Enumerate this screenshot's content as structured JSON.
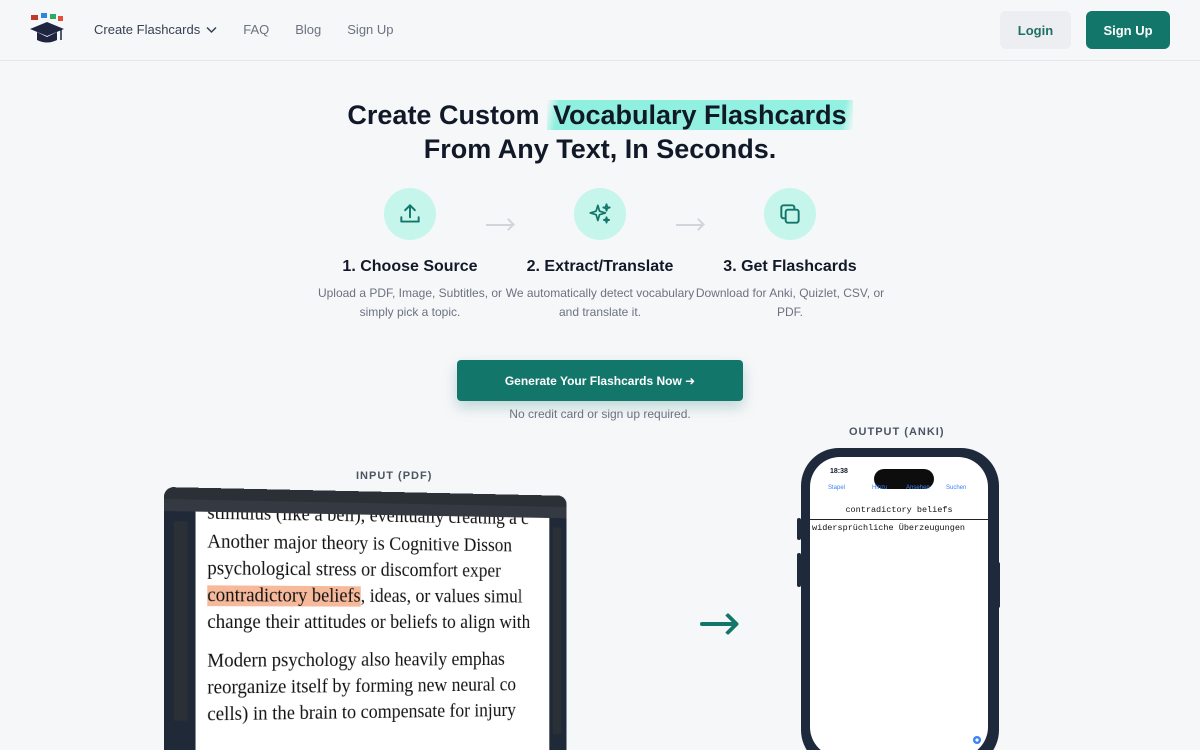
{
  "nav": {
    "menu_label": "Create Flashcards",
    "faq": "FAQ",
    "blog": "Blog",
    "signup_link": "Sign Up",
    "login_button": "Login",
    "signup_button": "Sign Up"
  },
  "hero": {
    "title_part1": "Create Custom",
    "title_highlight": "Vocabulary Flashcards",
    "title_line2": "From Any Text, In Seconds."
  },
  "steps": [
    {
      "icon": "upload-icon",
      "title": "1. Choose Source",
      "description": "Upload a PDF, Image, Subtitles, or simply pick a topic."
    },
    {
      "icon": "sparkles-icon",
      "title": "2. Extract/Translate",
      "description": "We automatically detect vocabulary and translate it."
    },
    {
      "icon": "copy-icon",
      "title": "3. Get Flashcards",
      "description": "Download for Anki, Quizlet, CSV, or PDF."
    }
  ],
  "cta": {
    "button": "Generate Your Flashcards Now ➜",
    "note": "No credit card or sign up required."
  },
  "demo": {
    "input_label": "INPUT (PDF)",
    "output_label": "OUTPUT (ANKI)",
    "pdf_lines": [
      "stimulus (like a bell), eventually creating a c",
      "Another major theory is Cognitive Disson",
      "psychological stress or discomfort exper",
      "contradictory beliefs",
      ", ideas, or values simul",
      "change their attitudes or beliefs to align with",
      "Modern psychology also heavily emphas",
      "reorganize itself by forming new neural co",
      "cells) in the brain to compensate for injury"
    ],
    "phone": {
      "time": "18:38",
      "tabs": [
        "Stapel",
        "Hinzu",
        "Ansehen",
        "Suchen"
      ],
      "front": "contradictory beliefs",
      "back": "widersprüchliche Überzeugungen"
    }
  },
  "colors": {
    "brand": "#13766b",
    "highlight": "#93f1e1",
    "pdf_highlight": "#f6b99b"
  }
}
